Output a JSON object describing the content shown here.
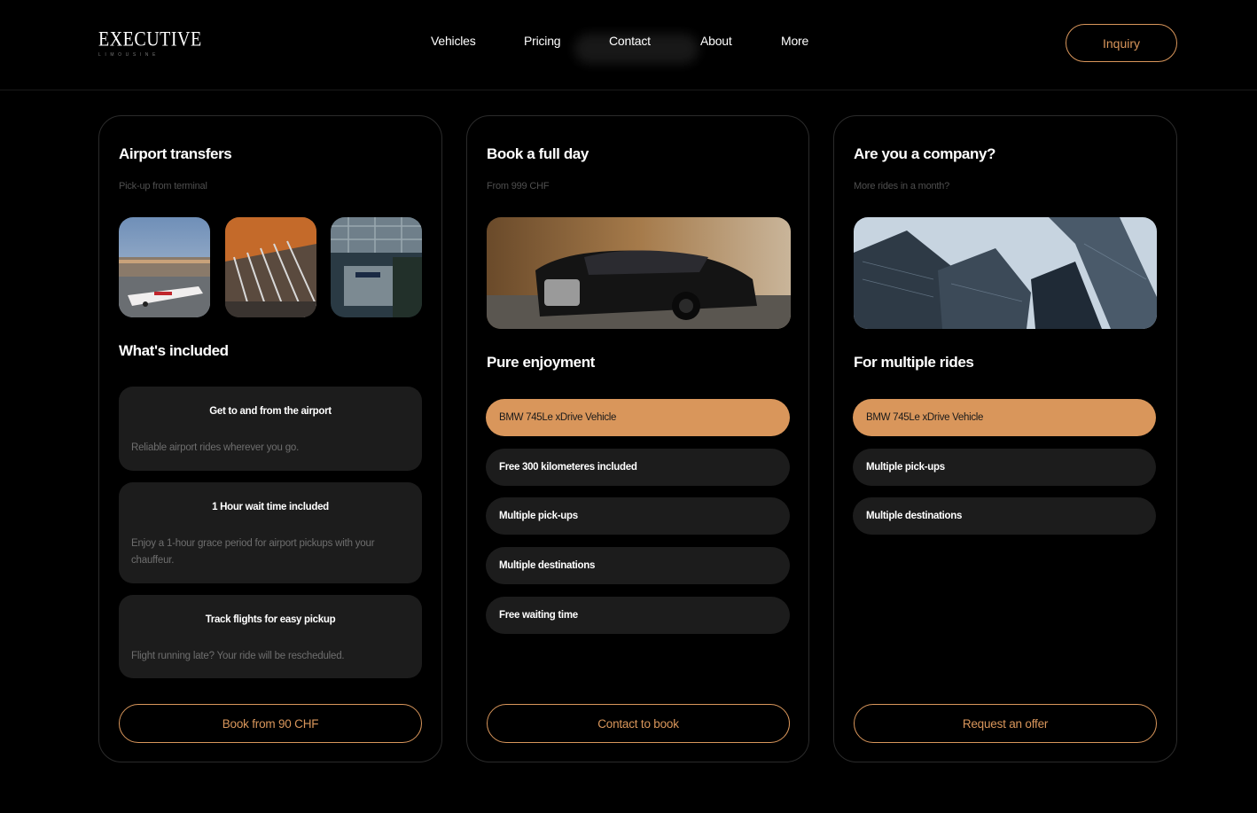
{
  "header": {
    "logo_main": "EXECUTIVE",
    "logo_sub": "LIMOUSINE",
    "nav": [
      "Vehicles",
      "Pricing",
      "Contact",
      "About",
      "More"
    ],
    "inquiry_label": "Inquiry"
  },
  "cards": [
    {
      "title": "Airport transfers",
      "subtitle": "Pick-up from terminal",
      "section_title": "What's included",
      "features": [
        {
          "title": "Get to and from the airport",
          "desc": "Reliable airport rides wherever you go."
        },
        {
          "title": "1 Hour wait time included",
          "desc": "Enjoy a 1-hour grace period for airport pickups with your chauffeur."
        },
        {
          "title": "Track flights for easy pickup",
          "desc": "Flight running late? Your ride will be rescheduled."
        }
      ],
      "button_label": "Book from 90 CHF"
    },
    {
      "title": "Book a full day",
      "subtitle": "From 999 CHF",
      "section_title": "Pure enjoyment",
      "pills": [
        "BMW 745Le xDrive Vehicle",
        "Free 300 kilometeres included",
        "Multiple pick-ups",
        "Multiple destinations",
        "Free waiting time"
      ],
      "button_label": "Contact to book"
    },
    {
      "title": "Are you a company?",
      "subtitle": "More rides in a month?",
      "section_title": "For multiple rides",
      "pills": [
        "BMW 745Le xDrive Vehicle",
        "Multiple pick-ups",
        "Multiple destinations"
      ],
      "button_label": "Request an offer"
    }
  ],
  "colors": {
    "accent": "#d9965b",
    "background": "#000000",
    "surface": "#1c1c1c",
    "muted_text": "#6e6e6e"
  }
}
